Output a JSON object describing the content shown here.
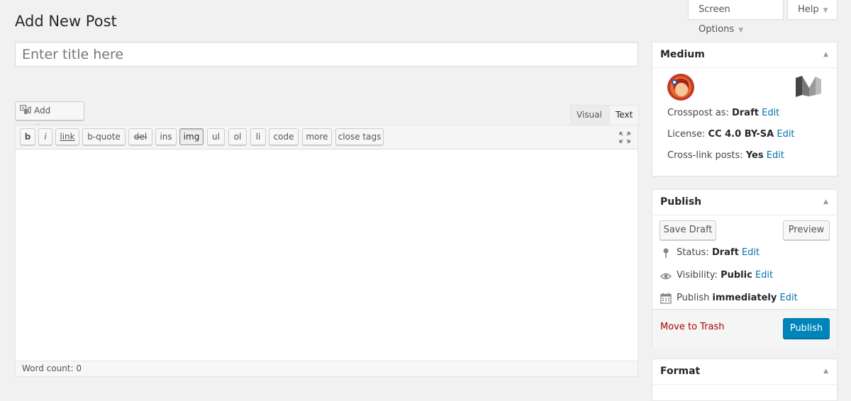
{
  "screen_meta": {
    "screen_options": "Screen Options",
    "help": "Help"
  },
  "page": {
    "title": "Add New Post",
    "title_placeholder": "Enter title here"
  },
  "editor": {
    "add_media": "Add Media",
    "tabs": [
      "Visual",
      "Text"
    ],
    "active_tab": "Text",
    "quicktags": [
      "b",
      "i",
      "link",
      "b-quote",
      "del",
      "ins",
      "img",
      "ul",
      "ol",
      "li",
      "code",
      "more",
      "close tags"
    ],
    "active_quicktag": "img",
    "word_count": "Word count: 0"
  },
  "medium_box": {
    "title": "Medium",
    "crosspost_label": "Crosspost as:",
    "crosspost_value": "Draft",
    "license_label": "License:",
    "license_value": "CC 4.0 BY-SA",
    "crosslink_label": "Cross-link posts:",
    "crosslink_value": "Yes",
    "edit": "Edit"
  },
  "publish_box": {
    "title": "Publish",
    "save_draft": "Save Draft",
    "preview": "Preview",
    "status_label": "Status:",
    "status_value": "Draft",
    "visibility_label": "Visibility:",
    "visibility_value": "Public",
    "publish_label": "Publish",
    "publish_value": "immediately",
    "edit": "Edit",
    "move_to_trash": "Move to Trash",
    "publish_button": "Publish"
  },
  "format_box": {
    "title": "Format"
  },
  "colors": {
    "accent": "#0073aa",
    "primary_button": "#0085ba",
    "trash": "#a00"
  }
}
